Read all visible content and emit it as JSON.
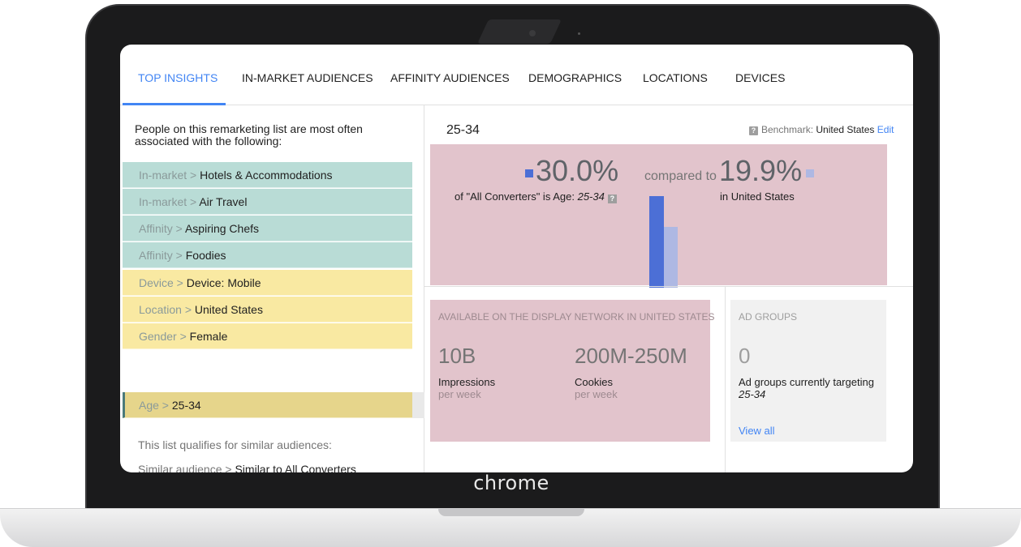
{
  "tabs": [
    {
      "label": "TOP INSIGHTS",
      "active": true
    },
    {
      "label": "IN-MARKET AUDIENCES",
      "active": false
    },
    {
      "label": "AFFINITY AUDIENCES",
      "active": false
    },
    {
      "label": "DEMOGRAPHICS",
      "active": false
    },
    {
      "label": "LOCATIONS",
      "active": false
    },
    {
      "label": "DEVICES",
      "active": false
    }
  ],
  "left": {
    "intro": "People on this remarketing list are most often associated with the following:",
    "insights": [
      {
        "category": "In-market",
        "value": "Hotels & Accommodations",
        "color": "#b9dcd6"
      },
      {
        "category": "In-market",
        "value": "Air Travel",
        "color": "#b9dcd6"
      },
      {
        "category": "Affinity",
        "value": "Aspiring Chefs",
        "color": "#b9dcd6"
      },
      {
        "category": "Affinity",
        "value": "Foodies",
        "color": "#b9dcd6"
      },
      {
        "category": "Device",
        "value": "Device: Mobile",
        "color": "#f9e9a2"
      },
      {
        "category": "Location",
        "value": "United States",
        "color": "#f9e9a2"
      },
      {
        "category": "Gender",
        "value": "Female",
        "color": "#f9e9a2"
      },
      {
        "category": "Age",
        "value": "25-34",
        "color": "#e6d58b",
        "selected": true
      }
    ],
    "separator": " > ",
    "qualify": "This list qualifies for similar audiences:",
    "similar": {
      "category": "Similar audience",
      "value": "Similar to All Converters"
    }
  },
  "detail": {
    "title": "25-34",
    "benchmark_label": "Benchmark:",
    "benchmark_country": "United States",
    "edit": "Edit",
    "primary_pct": "30.0%",
    "compared_to": "compared to",
    "benchmark_pct": "19.9%",
    "primary_caption_prefix": "of \"All Converters\" is Age:",
    "primary_caption_age": "25-34",
    "benchmark_caption": "in United States",
    "colors": {
      "primary": "#4c6fd6",
      "benchmark": "#aeb8e3"
    }
  },
  "chart_data": {
    "type": "bar",
    "categories": [
      "All Converters",
      "United States"
    ],
    "values": [
      30.0,
      19.9
    ],
    "ylim": [
      0,
      45
    ]
  },
  "available": {
    "title": "AVAILABLE ON THE DISPLAY NETWORK IN UNITED STATES",
    "impressions_value": "10B",
    "impressions_label": "Impressions",
    "impressions_sub": "per week",
    "cookies_value": "200M-250M",
    "cookies_label": "Cookies",
    "cookies_sub": "per week"
  },
  "ad_groups": {
    "title": "AD GROUPS",
    "count": "0",
    "desc": "Ad groups currently targeting",
    "desc_age": "25-34",
    "link": "View all"
  },
  "brand": "chrome"
}
